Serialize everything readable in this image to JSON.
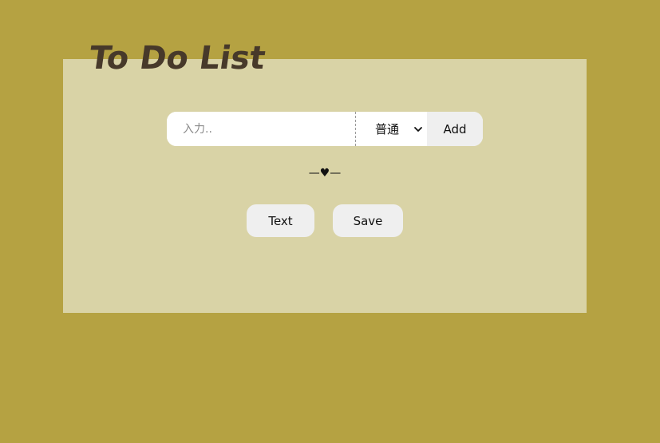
{
  "app": {
    "title": "To Do List"
  },
  "form": {
    "task_input_value": "",
    "task_input_placeholder": "入力..",
    "priority_selected": "普通",
    "add_label": "Add"
  },
  "divider": {
    "text": "—♥—"
  },
  "actions": {
    "text_label": "Text",
    "save_label": "Save"
  },
  "colors": {
    "page_background": "#b5a242",
    "panel_background": "#d9d3a6",
    "title_color": "#47392a",
    "button_background": "#efefef",
    "input_background": "#ffffff"
  },
  "icons": {
    "priority_dropdown": "chevron-down-icon"
  }
}
